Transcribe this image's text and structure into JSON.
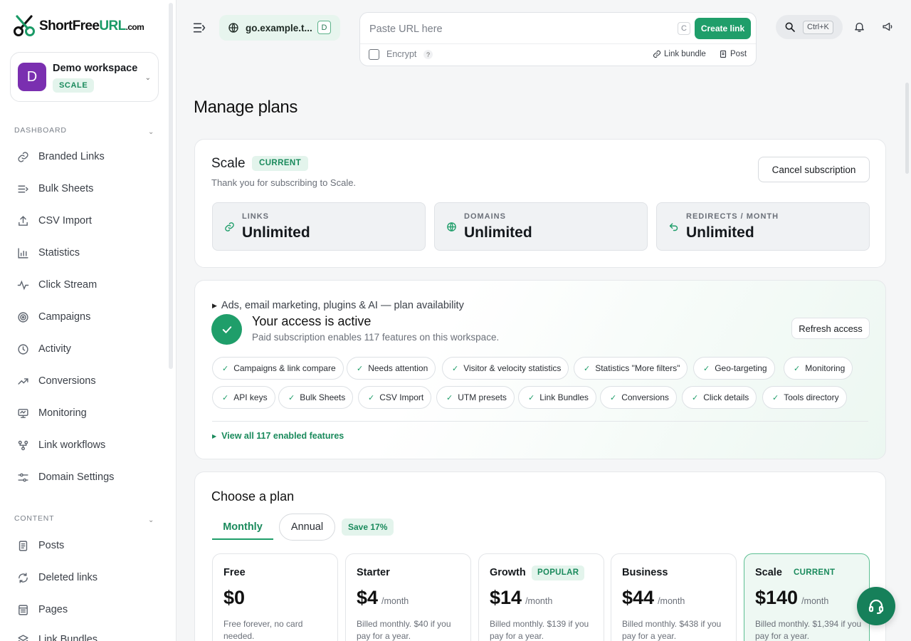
{
  "brand": {
    "name_part1": "Short",
    "name_part2": "Free",
    "name_part3": "URL",
    "name_part4": ".com"
  },
  "workspace": {
    "initial": "D",
    "name": "Demo workspace",
    "plan_badge": "SCALE"
  },
  "sidebar": {
    "dashboard_label": "DASHBOARD",
    "dashboard_items": [
      {
        "label": "Branded Links",
        "icon": "link-icon"
      },
      {
        "label": "Bulk Sheets",
        "icon": "list-icon"
      },
      {
        "label": "CSV Import",
        "icon": "upload-icon"
      },
      {
        "label": "Statistics",
        "icon": "bar-chart-icon"
      },
      {
        "label": "Click Stream",
        "icon": "pulse-icon"
      },
      {
        "label": "Campaigns",
        "icon": "target-icon"
      },
      {
        "label": "Activity",
        "icon": "clock-icon"
      },
      {
        "label": "Conversions",
        "icon": "trend-icon"
      },
      {
        "label": "Monitoring",
        "icon": "monitor-icon"
      },
      {
        "label": "Link workflows",
        "icon": "workflow-icon"
      },
      {
        "label": "Domain Settings",
        "icon": "sliders-icon"
      }
    ],
    "content_label": "CONTENT",
    "content_items": [
      {
        "label": "Posts",
        "icon": "document-icon"
      },
      {
        "label": "Deleted links",
        "icon": "refresh-icon"
      },
      {
        "label": "Pages",
        "icon": "page-icon"
      },
      {
        "label": "Link Bundles",
        "icon": "layers-icon"
      }
    ]
  },
  "header": {
    "domain": "go.example.t...",
    "domain_key": "D",
    "url_placeholder": "Paste URL here",
    "url_key": "C",
    "create_label": "Create link",
    "encrypt_label": "Encrypt",
    "help_mark": "?",
    "link_bundle_label": "Link bundle",
    "post_label": "Post",
    "search_shortcut": "Ctrl+K"
  },
  "page": {
    "title": "Manage plans"
  },
  "current_plan": {
    "name": "Scale",
    "badge": "CURRENT",
    "subtitle": "Thank you for subscribing to Scale.",
    "cancel_label": "Cancel subscription",
    "stats": [
      {
        "label": "LINKS",
        "value": "Unlimited",
        "icon": "link-icon"
      },
      {
        "label": "DOMAINS",
        "value": "Unlimited",
        "icon": "globe-icon"
      },
      {
        "label": "REDIRECTS / MONTH",
        "value": "Unlimited",
        "icon": "redirect-icon"
      }
    ]
  },
  "access": {
    "disclosure": "Ads, email marketing, plugins & AI — plan availability",
    "title": "Your access is active",
    "subtitle": "Paid subscription enables 117 features on this workspace.",
    "refresh_label": "Refresh access",
    "features_row1": [
      "Campaigns & link compare",
      "Needs attention",
      "Visitor & velocity statistics",
      "Statistics \"More filters\"",
      "Geo-targeting",
      "Monitoring"
    ],
    "features_row2": [
      "API keys",
      "Bulk Sheets",
      "CSV Import",
      "UTM presets",
      "Link Bundles",
      "Conversions",
      "Click details",
      "Tools directory"
    ],
    "view_all": "View all 117 enabled features"
  },
  "choose": {
    "title": "Choose a plan",
    "tab_monthly": "Monthly",
    "tab_annual": "Annual",
    "save_badge": "Save 17%",
    "plans": [
      {
        "name": "Free",
        "price": "$0",
        "per": "",
        "note": "Free forever, no card needed."
      },
      {
        "name": "Starter",
        "price": "$4",
        "per": "/month",
        "note": "Billed monthly. $40 if you pay for a year."
      },
      {
        "name": "Growth",
        "badge": "POPULAR",
        "price": "$14",
        "per": "/month",
        "note": "Billed monthly. $139 if you pay for a year."
      },
      {
        "name": "Business",
        "price": "$44",
        "per": "/month",
        "note": "Billed monthly. $438 if you pay for a year."
      },
      {
        "name": "Scale",
        "badge": "CURRENT",
        "price": "$140",
        "per": "/month",
        "note": "Billed monthly. $1,394 if you pay for a year."
      }
    ]
  },
  "colors": {
    "accent": "#1f9e6a",
    "accent_dark": "#16805a",
    "avatar": "#7a2fb0"
  }
}
